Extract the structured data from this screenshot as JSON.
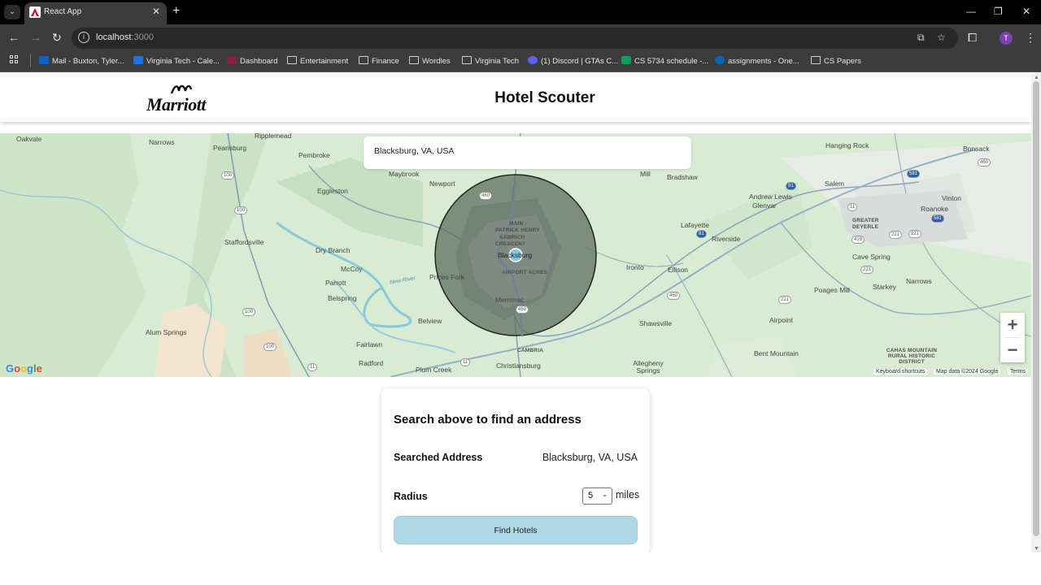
{
  "browser": {
    "tab_title": "React App",
    "url_host": "localhost",
    "url_port": ":3000",
    "avatar_letter": "T",
    "bookmarks": [
      "Mail - Buxton, Tyler...",
      "Virginia Tech - Cale...",
      "Dashboard",
      "Entertainment",
      "Finance",
      "Wordles",
      "Virginia Tech",
      "(1) Discord | GTAs C...",
      "CS 5734 schedule -...",
      "assignments - One...",
      "CS Papers"
    ]
  },
  "header": {
    "logo_text": "Marriott",
    "title": "Hotel Scouter"
  },
  "map": {
    "search_value": "Blacksburg, VA, USA",
    "labels": {
      "oakvale": "Oakvale",
      "narrows_w": "Narrows",
      "pearisburg": "Pearisburg",
      "ripplemead": "Ripplemead",
      "pembroke": "Pembroke",
      "maybrook": "Maybrook",
      "newport": "Newport",
      "eggleston": "Eggleston",
      "staffordsville": "Staffordsville",
      "dry_branch": "Dry Branch",
      "mccoy": "McCoy",
      "parrott": "Parrott",
      "belspring": "Belspring",
      "new_river": "New River",
      "prices_fork": "Prices Fork",
      "belview": "Belview",
      "alum_springs": "Alum Springs",
      "fairlawn": "Fairlawn",
      "radford": "Radford",
      "plum_creek": "Plum Creek",
      "christiansburg": "Christiansburg",
      "cambria": "CAMBRIA",
      "merrimac": "Merrimac",
      "main_patrick": "MAIN -",
      "patrick_henry": "PATRICK HENRY",
      "kabrich": "KABRICH",
      "crescent": "CRESCENT",
      "blacksburg": "Blacksburg",
      "airport_acres": "AIRPORT ACRES",
      "mill": "Mill",
      "bradshaw": "Bradshaw",
      "andrew_lewis": "Andrew Lewis",
      "glenvar": "Glenvar",
      "salem": "Salem",
      "lafayette": "Lafayette",
      "riverside": "Riverside",
      "ironto": "Ironto",
      "ellison": "Ellison",
      "shawsville": "Shawsville",
      "allegheny_springs": "Allegheny Springs",
      "hanging_rock": "Hanging Rock",
      "bonsack": "Bonsack",
      "vinton": "Vinton",
      "roanoke": "Roanoke",
      "greater_deyerle": "GREATER DEYERLE",
      "cave_spring": "Cave Spring",
      "poages_mill": "Poages Mill",
      "starkey": "Starkey",
      "narrows_e": "Narrows",
      "airpoint": "Airpoint",
      "bent_mountain": "Bent Mountain",
      "cahas": "CAHAS MOUNTAIN RURAL HISTORIC DISTRICT"
    },
    "shields": [
      "100",
      "100",
      "100",
      "100",
      "460",
      "460",
      "460",
      "11",
      "11",
      "81",
      "81",
      "581",
      "581",
      "11",
      "221",
      "419",
      "221",
      "220",
      "221",
      "460",
      "221"
    ],
    "zoom_in": "+",
    "zoom_out": "−",
    "google": [
      "G",
      "o",
      "o",
      "g",
      "l",
      "e"
    ],
    "attribution": [
      "Keyboard shortcuts",
      "Map data ©2024 Google",
      "Terms"
    ]
  },
  "card": {
    "heading": "Search above to find an address",
    "searched_address_label": "Searched Address",
    "searched_address_value": "Blacksburg, VA, USA",
    "radius_label": "Radius",
    "radius_value": "5",
    "radius_unit": "miles",
    "find_button": "Find Hotels"
  },
  "colors": {
    "button_bg": "#add8e6",
    "radius_circle": "#596b5c",
    "map_bg": "#d8ecd4"
  }
}
